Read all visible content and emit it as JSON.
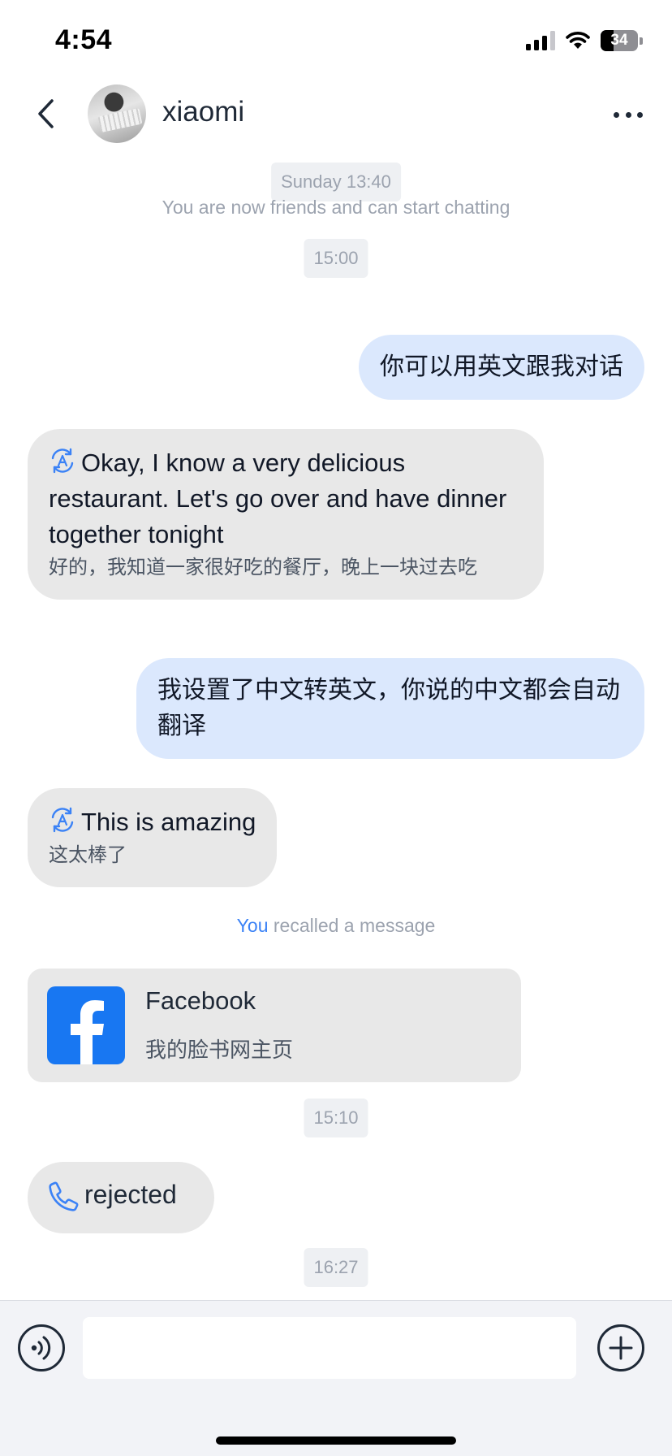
{
  "status_bar": {
    "time": "4:54",
    "battery_level": "34",
    "icons": [
      "cellular-signal-icon",
      "wifi-icon",
      "battery-icon"
    ]
  },
  "header": {
    "contact_name": "xiaomi",
    "icons": [
      "back-chevron-icon",
      "more-ellipsis-icon"
    ]
  },
  "chat": {
    "time_1": "Sunday 13:40",
    "friends_notice": "You are now friends and can start chatting",
    "time_2": "15:00",
    "msg_out_1": "你可以用英文跟我对话",
    "msg_in_1": {
      "text": "Okay, I know a very delicious restaurant. Let's go over and have dinner together tonight",
      "original": "好的，我知道一家很好吃的餐厅，晚上一块过去吃"
    },
    "msg_out_2": "我设置了中文转英文，你说的中文都会自动翻译",
    "msg_in_2": {
      "text": "This is amazing",
      "original": "这太棒了"
    },
    "recall_actor": "You",
    "recall_text": "recalled a message",
    "card": {
      "title": "Facebook",
      "subtitle": "我的脸书网主页",
      "icon": "facebook-logo-icon"
    },
    "time_3": "15:10",
    "call": {
      "label": "rejected",
      "icon": "phone-icon"
    },
    "time_4": "16:27"
  },
  "input_bar": {
    "value": "",
    "icons": [
      "voice-icon",
      "plus-icon"
    ]
  },
  "colors": {
    "outgoing_bubble": "#dbe8fd",
    "incoming_bubble": "#e8e8e8",
    "accent": "#3b82f6",
    "facebook_blue": "#1877f2"
  }
}
